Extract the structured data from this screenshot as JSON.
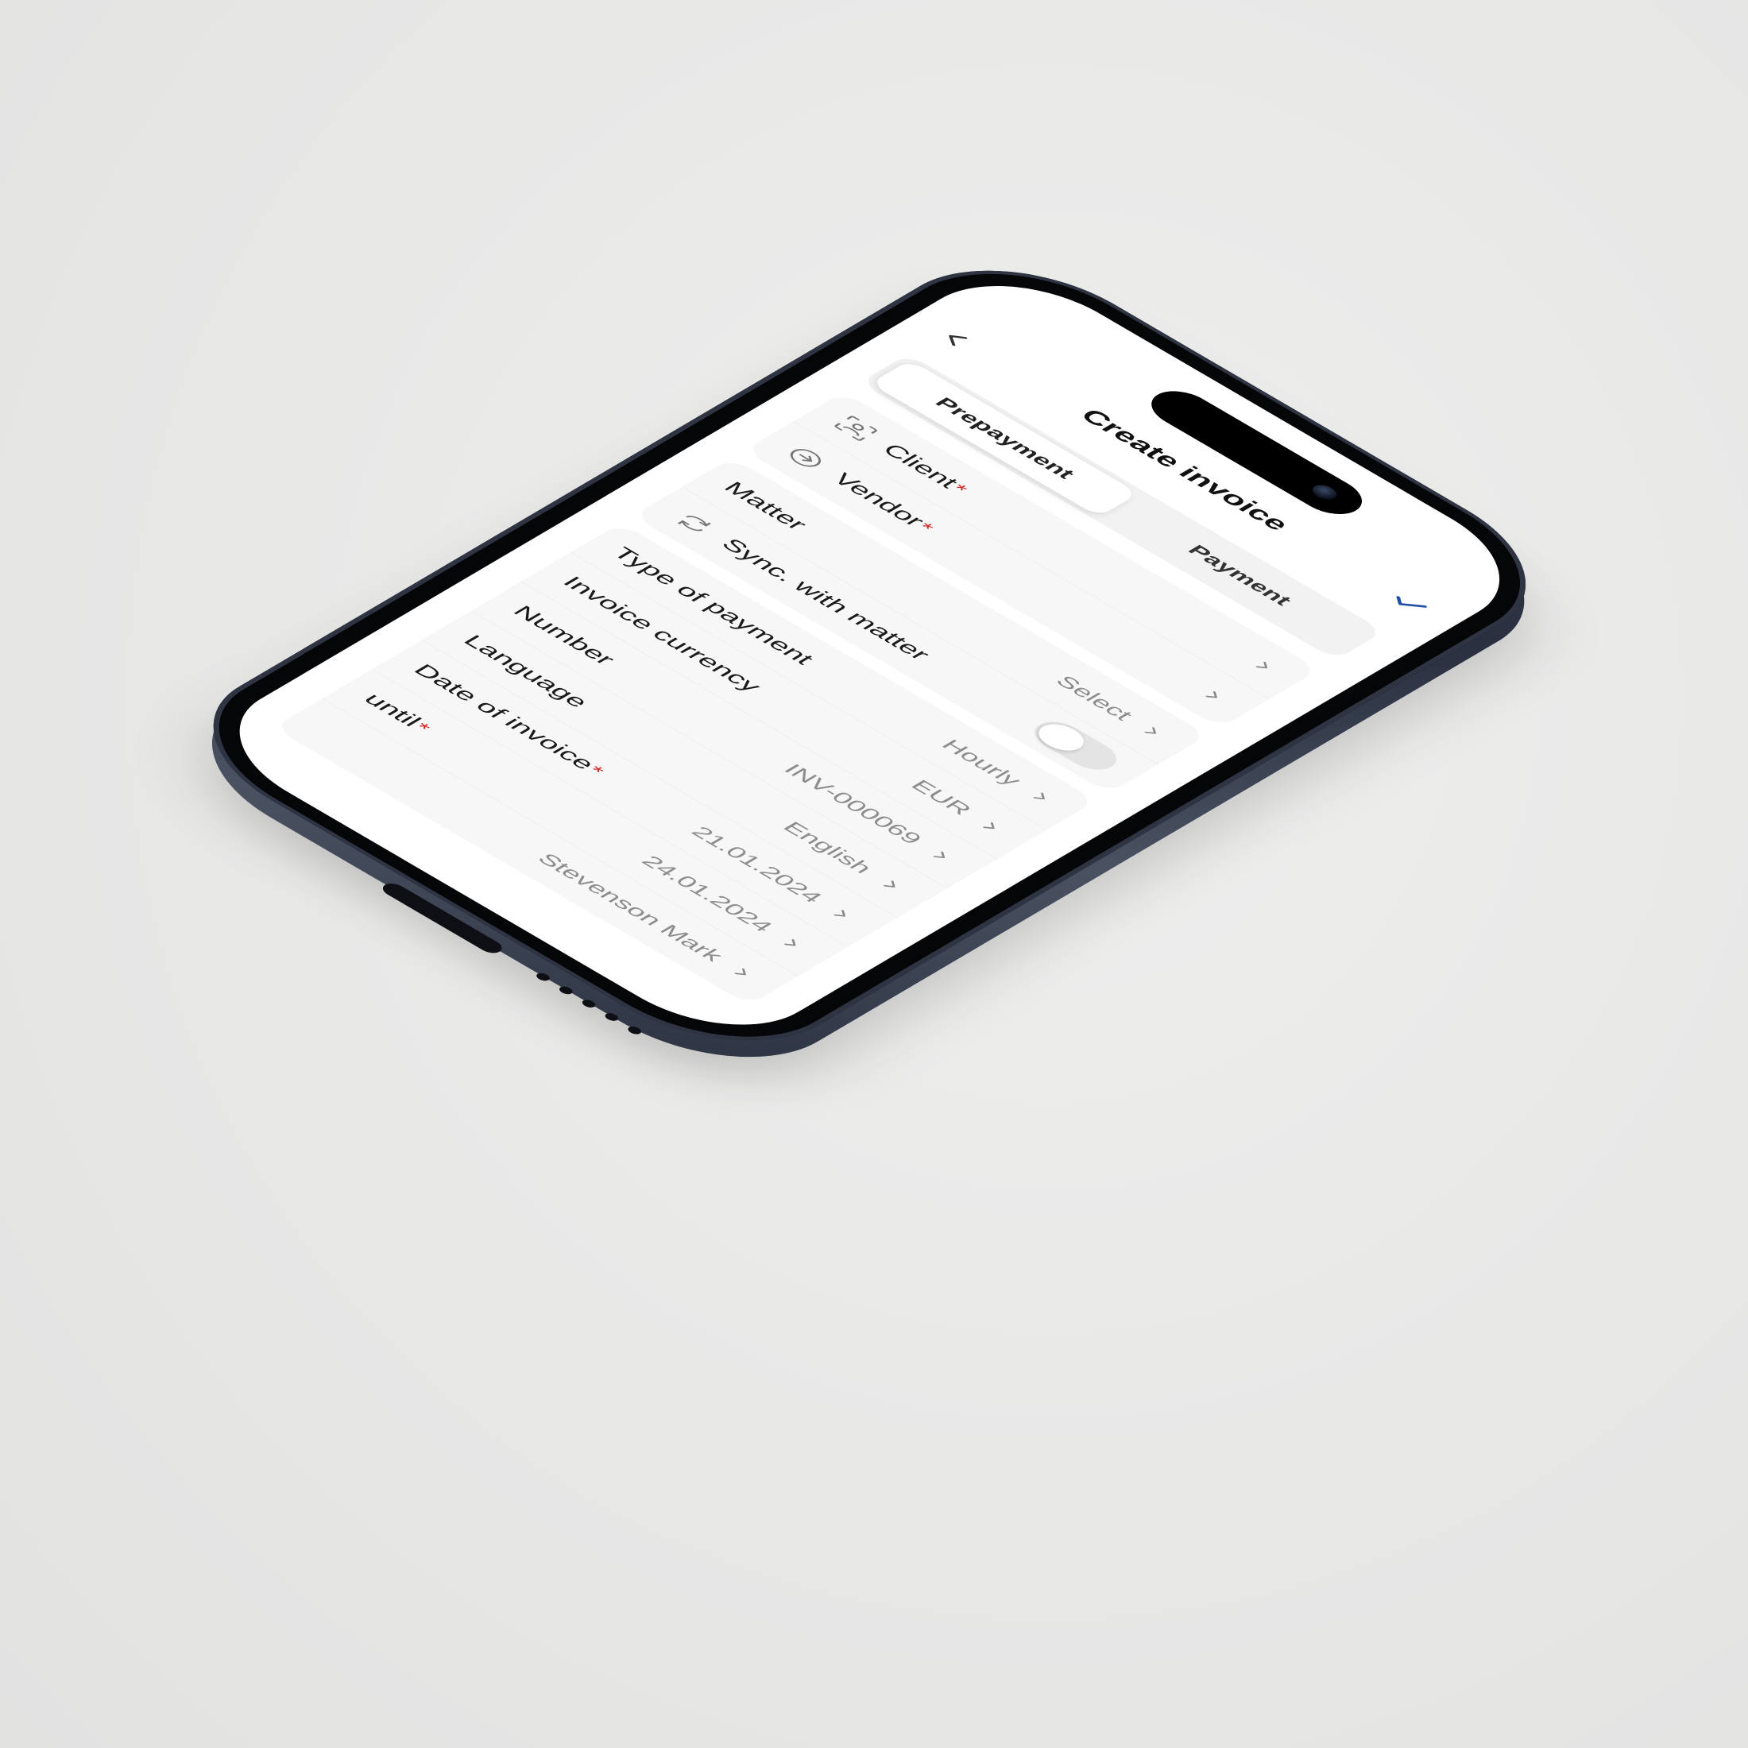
{
  "header": {
    "title": "Create invoice",
    "back_icon": "chevron-left-icon",
    "confirm_icon": "checkmark-icon",
    "confirm_color": "#1f4fa8"
  },
  "tabs": {
    "items": [
      {
        "label": "Prepayment",
        "active": true
      },
      {
        "label": "Payment",
        "active": false
      }
    ]
  },
  "form": {
    "client": {
      "label": "Client",
      "required": "*",
      "icon": "client-scan-icon"
    },
    "vendor": {
      "label": "Vendor",
      "required": "*",
      "icon": "vendor-arrow-icon"
    },
    "matter": {
      "label": "Matter",
      "value": "Select"
    },
    "sync": {
      "label": "Sync. with matter",
      "icon": "sync-icon",
      "enabled": false
    },
    "type_of_payment": {
      "label": "Type of payment",
      "value": "Hourly"
    },
    "invoice_currency": {
      "label": "Invoice currency",
      "value": "EUR"
    },
    "number": {
      "label": "Number",
      "value": "INV-000069"
    },
    "language": {
      "label": "Language",
      "value": "English"
    },
    "date_of_invoice": {
      "label": "Date of invoice",
      "required": "*",
      "value": "21.01.2024"
    },
    "due_until": {
      "label": "until",
      "required": "*",
      "value": "24.01.2024"
    },
    "responsible": {
      "value": "Stevenson Mark"
    }
  },
  "colors": {
    "required": "#d62828",
    "accent": "#1f4fa8"
  }
}
